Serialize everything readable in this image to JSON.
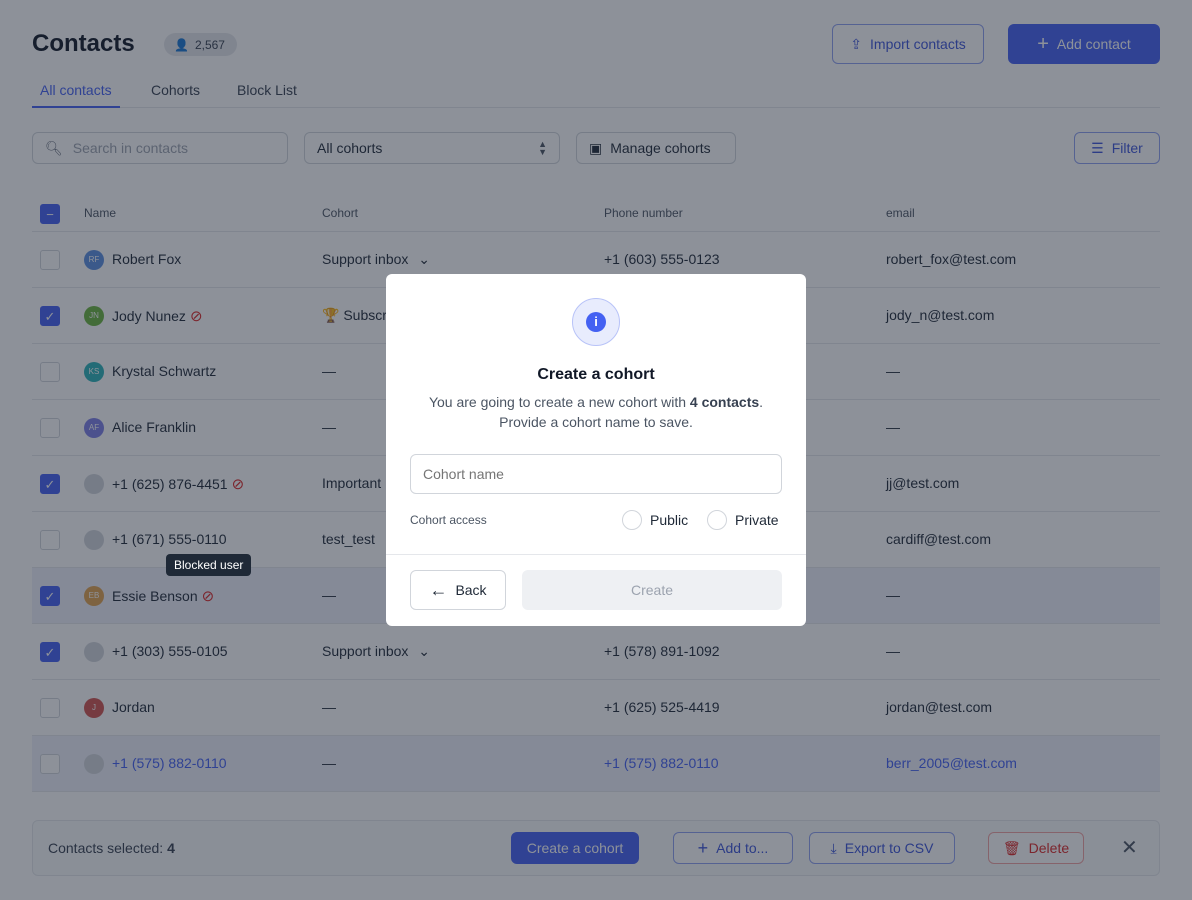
{
  "header": {
    "title": "Contacts",
    "count": "2,567",
    "import_label": "Import contacts",
    "add_label": "Add contact"
  },
  "tabs": [
    "All contacts",
    "Cohorts",
    "Block List"
  ],
  "toolbar": {
    "search_placeholder": "Search in contacts",
    "cohort_select": "All cohorts",
    "manage_label": "Manage cohorts",
    "filter_label": "Filter"
  },
  "table": {
    "headers": [
      "Name",
      "Cohort",
      "Phone number",
      "email"
    ],
    "rows": [
      {
        "name": "Robert Fox",
        "initials": "RF",
        "color": "#5b8fe0",
        "checked": false,
        "blocked": false,
        "cohort": "Support inbox",
        "dropdown": true,
        "phone": "+1 (603) 555-0123",
        "email": "robert_fox@test.com"
      },
      {
        "name": "Jody Nunez",
        "initials": "JN",
        "color": "#6bb53f",
        "checked": true,
        "blocked": true,
        "cohort": "🏆 Subscr",
        "dropdown": false,
        "phone": "",
        "email": "jody_n@test.com"
      },
      {
        "name": "Krystal Schwartz",
        "initials": "KS",
        "color": "#2bb3b8",
        "checked": false,
        "blocked": false,
        "cohort": "—",
        "dropdown": false,
        "phone": "",
        "email": "—"
      },
      {
        "name": "Alice Franklin",
        "initials": "AF",
        "color": "#7c7fe6",
        "checked": false,
        "blocked": false,
        "cohort": "—",
        "dropdown": false,
        "phone": "",
        "email": "—"
      },
      {
        "name": "+1 (625) 876-4451",
        "initials": "",
        "color": "#d1d5db",
        "checked": true,
        "blocked": true,
        "cohort": "Important",
        "dropdown": false,
        "phone": "",
        "email": "jj@test.com"
      },
      {
        "name": "+1 (671) 555-0110",
        "initials": "",
        "color": "#d1d5db",
        "checked": false,
        "blocked": false,
        "cohort": "test_test",
        "dropdown": false,
        "phone": "",
        "email": "cardiff@test.com"
      },
      {
        "name": "Essie Benson",
        "initials": "EB",
        "color": "#e0a24e",
        "checked": true,
        "blocked": true,
        "cohort": "—",
        "dropdown": false,
        "phone": "",
        "email": "—",
        "highlight": true
      },
      {
        "name": "+1 (303) 555-0105",
        "initials": "",
        "color": "#d1d5db",
        "checked": true,
        "blocked": false,
        "cohort": "Support inbox",
        "dropdown": true,
        "phone": "+1 (578) 891-1092",
        "email": "—"
      },
      {
        "name": "Jordan",
        "initials": "J",
        "color": "#d0534f",
        "checked": false,
        "blocked": false,
        "cohort": "—",
        "dropdown": false,
        "phone": "+1 (625) 525-4419",
        "email": "jordan@test.com"
      },
      {
        "name": "+1 (575) 882-0110",
        "initials": "",
        "color": "#d1d5db",
        "checked": false,
        "blocked": false,
        "cohort": "—",
        "dropdown": false,
        "phone": "+1 (575) 882-0110",
        "email": "berr_2005@test.com",
        "highlight": true,
        "link": true
      }
    ]
  },
  "tooltip": "Blocked user",
  "bulk": {
    "selected_label": "Contacts selected:",
    "selected_count": "4",
    "create_label": "Create a cohort",
    "add_label": "Add to...",
    "export_label": "Export to CSV",
    "delete_label": "Delete"
  },
  "modal": {
    "title": "Create a cohort",
    "desc_prefix": "You are going to create a new cohort with ",
    "desc_bold": "4 contacts",
    "desc_suffix": ".",
    "desc_line2": "Provide a cohort name to save.",
    "name_placeholder": "Cohort name",
    "access_label": "Cohort access",
    "public_label": "Public",
    "private_label": "Private",
    "back_label": "Back",
    "create_label": "Create"
  },
  "colors": {
    "accent": "#4461f2",
    "danger": "#dc2626"
  }
}
